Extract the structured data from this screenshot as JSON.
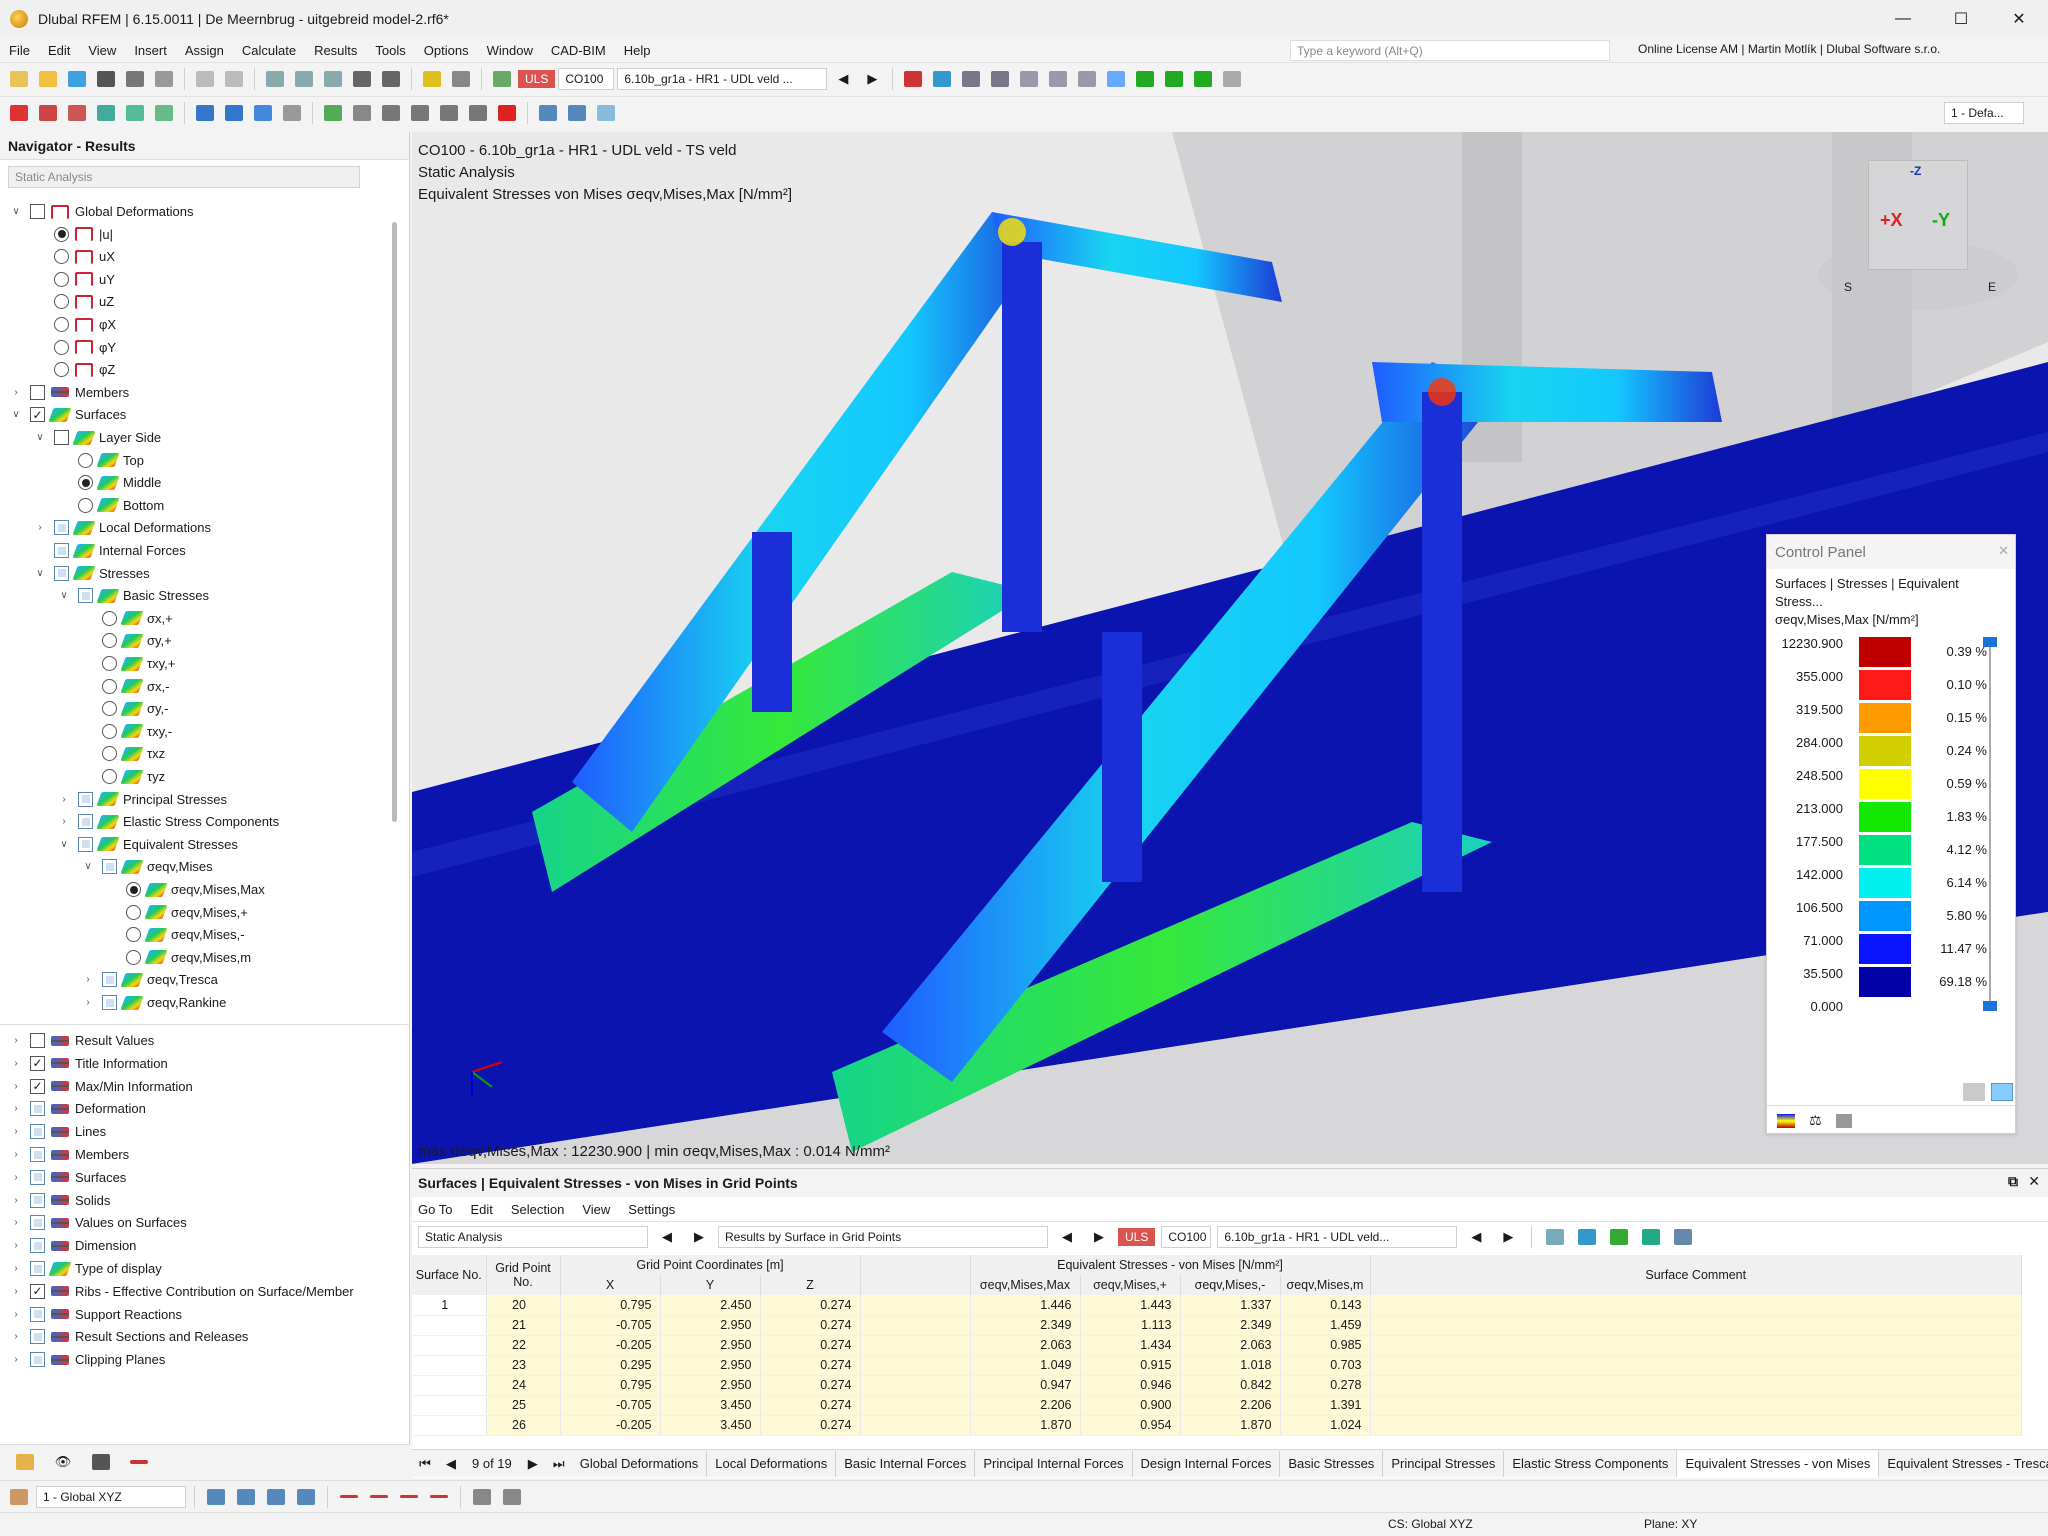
{
  "app": {
    "title": "Dlubal RFEM | 6.15.0011 | De Meernbrug - uitgebreid model-2.rf6*",
    "search_placeholder": "Type a keyword (Alt+Q)",
    "license": "Online License AM | Martin Motlík | Dlubal Software s.r.o.",
    "menu": [
      "File",
      "Edit",
      "View",
      "Insert",
      "Assign",
      "Calculate",
      "Results",
      "Tools",
      "Options",
      "Window",
      "CAD-BIM",
      "Help"
    ]
  },
  "toolbar": {
    "uls_badge": "ULS",
    "load_combo": "CO100",
    "load_combo_desc": "6.10b_gr1a - HR1 - UDL veld ...",
    "view_combo": "1 - Defa..."
  },
  "navigator": {
    "title": "Navigator - Results",
    "analysis_combo": "Static Analysis",
    "tree": [
      {
        "label": "Global Deformations",
        "level": 0,
        "expander": "v",
        "ctrl": "cb",
        "icon": "def"
      },
      {
        "label": "|u|",
        "level": 1,
        "ctrl": "rb-on",
        "icon": "def"
      },
      {
        "label": "uX",
        "level": 1,
        "ctrl": "rb",
        "icon": "def"
      },
      {
        "label": "uY",
        "level": 1,
        "ctrl": "rb",
        "icon": "def"
      },
      {
        "label": "uZ",
        "level": 1,
        "ctrl": "rb",
        "icon": "def"
      },
      {
        "label": "φX",
        "level": 1,
        "ctrl": "rb",
        "icon": "def"
      },
      {
        "label": "φY",
        "level": 1,
        "ctrl": "rb",
        "icon": "def"
      },
      {
        "label": "φZ",
        "level": 1,
        "ctrl": "rb",
        "icon": "def"
      },
      {
        "label": "Members",
        "level": 0,
        "expander": ">",
        "ctrl": "cb",
        "icon": "res"
      },
      {
        "label": "Surfaces",
        "level": 0,
        "expander": "v",
        "ctrl": "cb-on",
        "icon": "surf"
      },
      {
        "label": "Layer Side",
        "level": 1,
        "expander": "v",
        "ctrl": "cb",
        "icon": "surf"
      },
      {
        "label": "Top",
        "level": 2,
        "ctrl": "rb",
        "icon": "surf"
      },
      {
        "label": "Middle",
        "level": 2,
        "ctrl": "rb-on",
        "icon": "surf"
      },
      {
        "label": "Bottom",
        "level": 2,
        "ctrl": "rb",
        "icon": "surf"
      },
      {
        "label": "Local Deformations",
        "level": 1,
        "expander": ">",
        "ctrl": "cb-part",
        "icon": "surf"
      },
      {
        "label": "Internal Forces",
        "level": 1,
        "ctrl": "cb-part",
        "icon": "surf"
      },
      {
        "label": "Stresses",
        "level": 1,
        "expander": "v",
        "ctrl": "cb-part",
        "icon": "surf"
      },
      {
        "label": "Basic Stresses",
        "level": 2,
        "expander": "v",
        "ctrl": "cb-part",
        "icon": "surf"
      },
      {
        "label": "σx,+",
        "level": 3,
        "ctrl": "rb",
        "icon": "surf"
      },
      {
        "label": "σy,+",
        "level": 3,
        "ctrl": "rb",
        "icon": "surf"
      },
      {
        "label": "τxy,+",
        "level": 3,
        "ctrl": "rb",
        "icon": "surf"
      },
      {
        "label": "σx,-",
        "level": 3,
        "ctrl": "rb",
        "icon": "surf"
      },
      {
        "label": "σy,-",
        "level": 3,
        "ctrl": "rb",
        "icon": "surf"
      },
      {
        "label": "τxy,-",
        "level": 3,
        "ctrl": "rb",
        "icon": "surf"
      },
      {
        "label": "τxz",
        "level": 3,
        "ctrl": "rb",
        "icon": "surf"
      },
      {
        "label": "τyz",
        "level": 3,
        "ctrl": "rb",
        "icon": "surf"
      },
      {
        "label": "Principal Stresses",
        "level": 2,
        "expander": ">",
        "ctrl": "cb-part",
        "icon": "surf"
      },
      {
        "label": "Elastic Stress Components",
        "level": 2,
        "expander": ">",
        "ctrl": "cb-part",
        "icon": "surf"
      },
      {
        "label": "Equivalent Stresses",
        "level": 2,
        "expander": "v",
        "ctrl": "cb-part",
        "icon": "surf"
      },
      {
        "label": "σeqv,Mises",
        "level": 3,
        "expander": "v",
        "ctrl": "cb-part",
        "icon": "surf"
      },
      {
        "label": "σeqv,Mises,Max",
        "level": 4,
        "ctrl": "rb-on",
        "icon": "surf"
      },
      {
        "label": "σeqv,Mises,+",
        "level": 4,
        "ctrl": "rb",
        "icon": "surf"
      },
      {
        "label": "σeqv,Mises,-",
        "level": 4,
        "ctrl": "rb",
        "icon": "surf"
      },
      {
        "label": "σeqv,Mises,m",
        "level": 4,
        "ctrl": "rb",
        "icon": "surf"
      },
      {
        "label": "σeqv,Tresca",
        "level": 3,
        "expander": ">",
        "ctrl": "cb-part",
        "icon": "surf"
      },
      {
        "label": "σeqv,Rankine",
        "level": 3,
        "expander": ">",
        "ctrl": "cb-part",
        "icon": "surf"
      }
    ],
    "tree2": [
      {
        "label": "Result Values",
        "ctrl": "cb",
        "icon": "res"
      },
      {
        "label": "Title Information",
        "ctrl": "cb-on",
        "icon": "res"
      },
      {
        "label": "Max/Min Information",
        "ctrl": "cb-on",
        "icon": "res"
      },
      {
        "label": "Deformation",
        "ctrl": "cb-part",
        "icon": "res"
      },
      {
        "label": "Lines",
        "ctrl": "cb-part",
        "icon": "res"
      },
      {
        "label": "Members",
        "ctrl": "cb-part",
        "icon": "res"
      },
      {
        "label": "Surfaces",
        "ctrl": "cb-part",
        "icon": "res"
      },
      {
        "label": "Solids",
        "ctrl": "cb-part",
        "icon": "res"
      },
      {
        "label": "Values on Surfaces",
        "ctrl": "cb-part",
        "icon": "res"
      },
      {
        "label": "Dimension",
        "ctrl": "cb-part",
        "icon": "res"
      },
      {
        "label": "Type of display",
        "ctrl": "cb-part",
        "icon": "surf"
      },
      {
        "label": "Ribs - Effective Contribution on Surface/Member",
        "ctrl": "cb-on",
        "icon": "res"
      },
      {
        "label": "Support Reactions",
        "ctrl": "cb-part",
        "icon": "res"
      },
      {
        "label": "Result Sections and Releases",
        "ctrl": "cb-part",
        "icon": "res"
      },
      {
        "label": "Clipping Planes",
        "ctrl": "cb-part",
        "icon": "res"
      }
    ]
  },
  "viewport": {
    "line1": "CO100 - 6.10b_gr1a - HR1 - UDL veld - TS veld",
    "line2": "Static Analysis",
    "line3": "Equivalent Stresses von Mises σeqv,Mises,Max [N/mm²]",
    "maxmin": "max σeqv,Mises,Max : 12230.900 | min σeqv,Mises,Max : 0.014 N/mm²",
    "cube": {
      "x": "+X",
      "y": "-Y",
      "z": "-Z",
      "s": "S",
      "e": "E"
    }
  },
  "control_panel": {
    "title": "Control Panel",
    "subtitle1": "Surfaces | Stresses | Equivalent Stress...",
    "subtitle2": "σeqv,Mises,Max [N/mm²]",
    "values": [
      "12230.900",
      "355.000",
      "319.500",
      "284.000",
      "248.500",
      "213.000",
      "177.500",
      "142.000",
      "106.500",
      "71.000",
      "35.500",
      "0.000"
    ],
    "percents": [
      "0.39 %",
      "0.10 %",
      "0.15 %",
      "0.24 %",
      "0.59 %",
      "1.83 %",
      "4.12 %",
      "6.14 %",
      "5.80 %",
      "11.47 %",
      "69.18 %"
    ],
    "colors": [
      "#c00000",
      "#ff1a1a",
      "#ff9a00",
      "#d2cf00",
      "#ffff00",
      "#12e800",
      "#00e080",
      "#00f0f0",
      "#0096ff",
      "#0a14ff",
      "#0000a6"
    ]
  },
  "results": {
    "title": "Surfaces | Equivalent Stresses - von Mises in Grid Points",
    "menu": [
      "Go To",
      "Edit",
      "Selection",
      "View",
      "Settings"
    ],
    "analysis": "Static Analysis",
    "mode": "Results by Surface in Grid Points",
    "uls": "ULS",
    "co": "CO100",
    "co_desc": "6.10b_gr1a - HR1 - UDL veld...",
    "head": {
      "surface_no": "Surface No.",
      "grid_point_no": "Grid Point No.",
      "coords_group": "Grid Point Coordinates [m]",
      "x": "X",
      "y": "Y",
      "z": "Z",
      "stress_group": "Equivalent Stresses - von Mises [N/mm²]",
      "c1": "σeqv,Mises,Max",
      "c2": "σeqv,Mises,+",
      "c3": "σeqv,Mises,-",
      "c4": "σeqv,Mises,m",
      "comment": "Surface Comment"
    },
    "rows": [
      {
        "surface": "1",
        "gp": "20",
        "x": "0.795",
        "y": "2.450",
        "z": "0.274",
        "max": "1.446",
        "plus": "1.443",
        "minus": "1.337",
        "m": "0.143"
      },
      {
        "surface": "",
        "gp": "21",
        "x": "-0.705",
        "y": "2.950",
        "z": "0.274",
        "max": "2.349",
        "plus": "1.113",
        "minus": "2.349",
        "m": "1.459"
      },
      {
        "surface": "",
        "gp": "22",
        "x": "-0.205",
        "y": "2.950",
        "z": "0.274",
        "max": "2.063",
        "plus": "1.434",
        "minus": "2.063",
        "m": "0.985"
      },
      {
        "surface": "",
        "gp": "23",
        "x": "0.295",
        "y": "2.950",
        "z": "0.274",
        "max": "1.049",
        "plus": "0.915",
        "minus": "1.018",
        "m": "0.703"
      },
      {
        "surface": "",
        "gp": "24",
        "x": "0.795",
        "y": "2.950",
        "z": "0.274",
        "max": "0.947",
        "plus": "0.946",
        "minus": "0.842",
        "m": "0.278"
      },
      {
        "surface": "",
        "gp": "25",
        "x": "-0.705",
        "y": "3.450",
        "z": "0.274",
        "max": "2.206",
        "plus": "0.900",
        "minus": "2.206",
        "m": "1.391"
      },
      {
        "surface": "",
        "gp": "26",
        "x": "-0.205",
        "y": "3.450",
        "z": "0.274",
        "max": "1.870",
        "plus": "0.954",
        "minus": "1.870",
        "m": "1.024"
      }
    ],
    "pager": "9 of 19",
    "tabs": [
      "Global Deformations",
      "Local Deformations",
      "Basic Internal Forces",
      "Principal Internal Forces",
      "Design Internal Forces",
      "Basic Stresses",
      "Principal Stresses",
      "Elastic Stress Components",
      "Equivalent Stresses - von Mises",
      "Equivalent Stresses - Tresca"
    ]
  },
  "status": {
    "coord_system": "1 - Global XYZ",
    "cs": "CS: Global XYZ",
    "plane": "Plane: XY"
  }
}
